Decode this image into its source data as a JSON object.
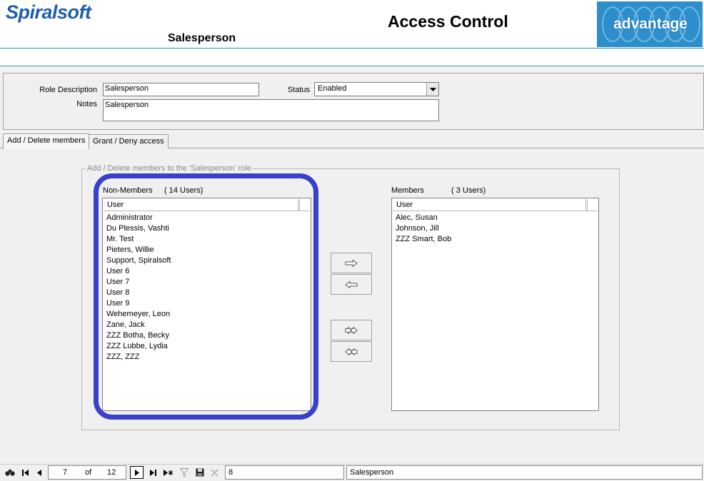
{
  "header": {
    "logo_text": "Spiralsoft",
    "title": "Access Control",
    "subtitle": "Salesperson",
    "brand_text": "advantage"
  },
  "form": {
    "role_description_label": "Role Description",
    "role_description_value": "Salesperson",
    "status_label": "Status",
    "status_value": "Enabled",
    "notes_label": "Notes",
    "notes_value": "Salesperson"
  },
  "tabs": [
    {
      "label": "Add / Delete members",
      "active": true
    },
    {
      "label": "Grant / Deny access",
      "active": false
    }
  ],
  "group": {
    "legend": "Add / Delete members to the 'Salesperson' role"
  },
  "non_members": {
    "caption": "Non-Members",
    "count": "( 14 Users)",
    "column": "User",
    "users": [
      "Administrator",
      "Du Plessis, Vashti",
      "Mr. Test",
      "Pieters, Willie",
      "Support, Spiralsoft",
      "User 6",
      "User 7",
      "User 8",
      "User 9",
      "Wehemeyer, Leon",
      "Zane, Jack",
      "ZZZ Botha, Becky",
      "ZZZ Lubbe, Lydia",
      "ZZZ, ZZZ"
    ]
  },
  "members": {
    "caption": "Members",
    "count": "( 3 Users)",
    "column": "User",
    "users": [
      "Alec, Susan",
      "Johnson, Jill",
      "ZZZ Smart, Bob"
    ]
  },
  "transfer_buttons": {
    "add_icon": "arrow-right-icon",
    "remove_icon": "arrow-left-icon",
    "add_all_icon": "double-arrow-right-icon",
    "remove_all_icon": "double-arrow-left-icon"
  },
  "navbar": {
    "current_record": "7",
    "of_label": "of",
    "total_records": "12",
    "filter_value": "8",
    "status_text": "Salesperson"
  },
  "colors": {
    "accent_line": "#2a9fc0",
    "logo_blue": "#1e5fa8",
    "brand_bg": "#2d8ecb",
    "highlight_ring": "#3a3fcc"
  }
}
